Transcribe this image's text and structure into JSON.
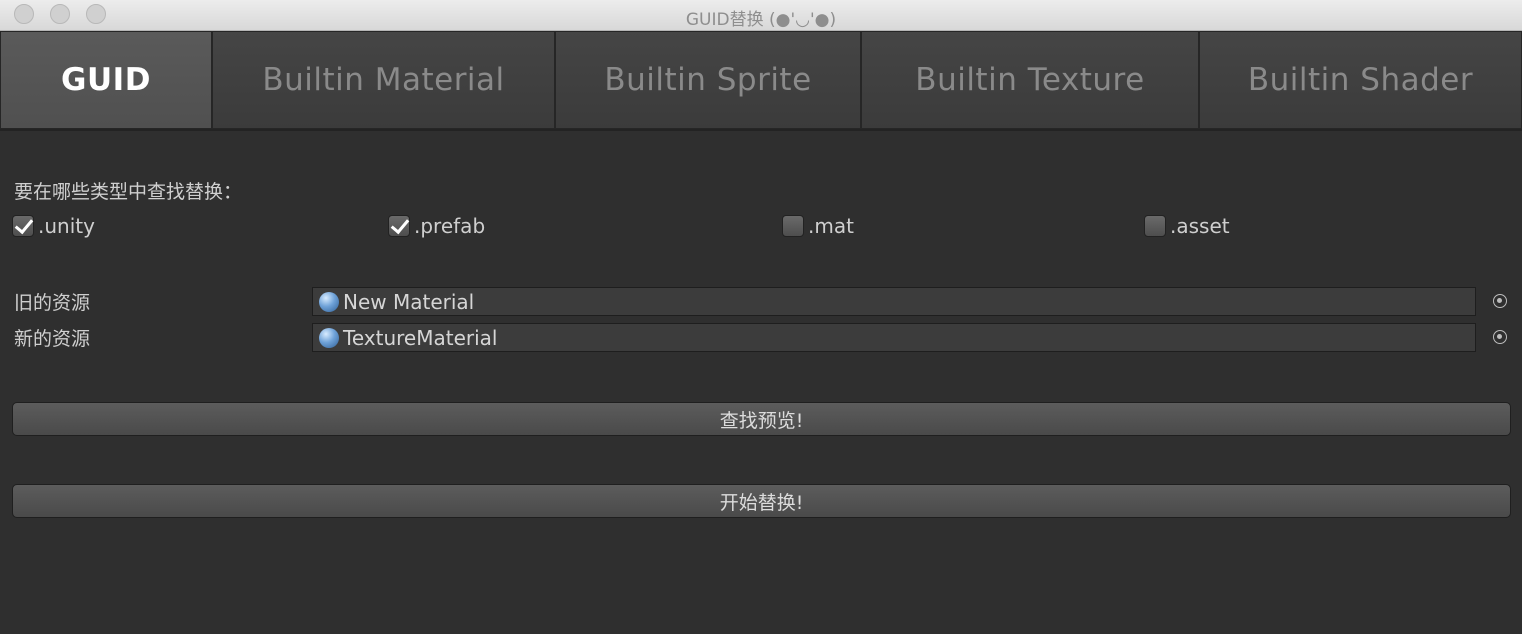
{
  "window": {
    "title": "GUID替换 (●'◡'●)"
  },
  "tabs": [
    {
      "label": "GUID",
      "active": true
    },
    {
      "label": "Builtin Material",
      "active": false
    },
    {
      "label": "Builtin Sprite",
      "active": false
    },
    {
      "label": "Builtin Texture",
      "active": false
    },
    {
      "label": "Builtin Shader",
      "active": false
    }
  ],
  "search": {
    "prompt": "要在哪些类型中查找替换：",
    "types": [
      {
        "label": ".unity",
        "checked": true
      },
      {
        "label": ".prefab",
        "checked": true
      },
      {
        "label": ".mat",
        "checked": false
      },
      {
        "label": ".asset",
        "checked": false
      }
    ]
  },
  "fields": {
    "old": {
      "label": "旧的资源",
      "value": "New Material",
      "icon": "material-sphere-icon"
    },
    "new": {
      "label": "新的资源",
      "value": "TextureMaterial",
      "icon": "material-sphere-icon"
    }
  },
  "buttons": {
    "preview": "查找预览!",
    "replace": "开始替换!"
  }
}
